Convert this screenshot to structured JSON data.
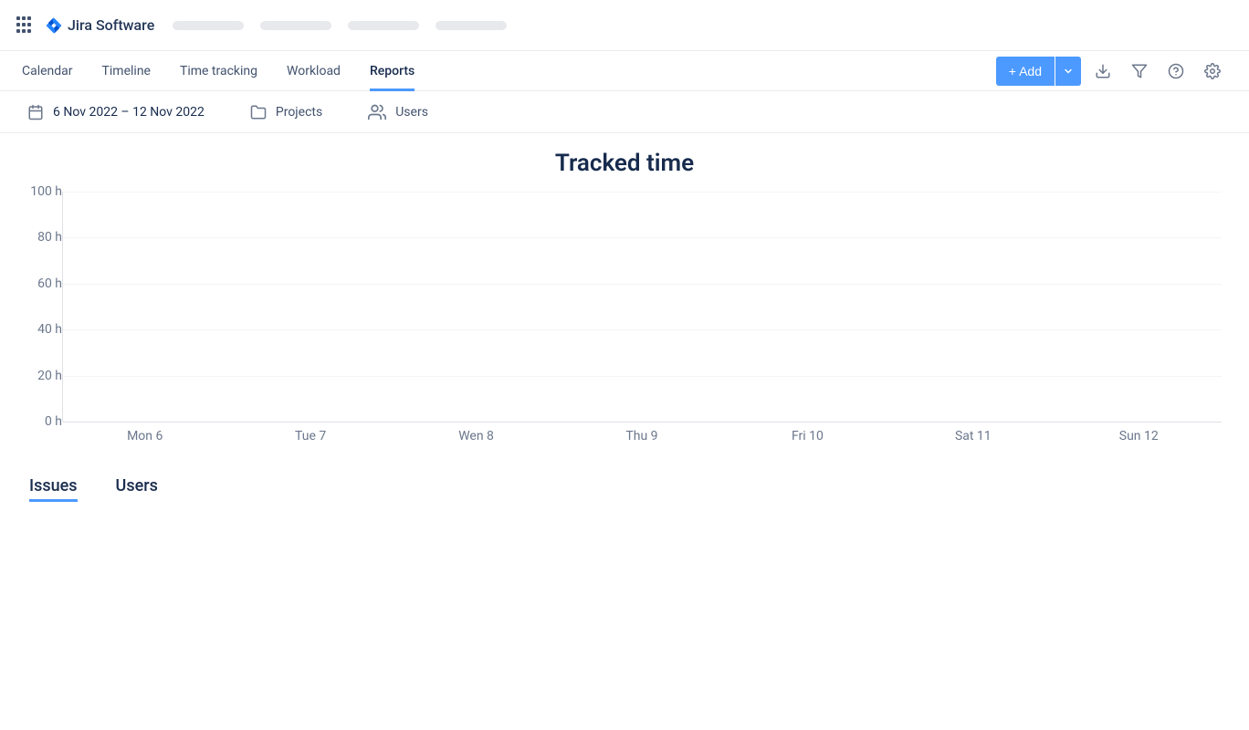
{
  "app_name": "Jira Software",
  "nav": {
    "tabs": [
      "Calendar",
      "Timeline",
      "Time tracking",
      "Workload",
      "Reports"
    ],
    "active_index": 4,
    "add_label": "+ Add"
  },
  "filters": {
    "date_range": "6 Nov 2022 – 12 Nov 2022",
    "projects_label": "Projects",
    "users_label": "Users"
  },
  "chart_data": {
    "type": "bar",
    "title": "Tracked time",
    "xlabel": "",
    "ylabel": "",
    "y_ticks": [
      "100 h",
      "80 h",
      "60 h",
      "40 h",
      "20 h",
      "0 h"
    ],
    "ylim": [
      0,
      100
    ],
    "categories": [
      "Mon 6",
      "Tue 7",
      "Wen 8",
      "Thu 9",
      "Fri 10",
      "Sat 11",
      "Sun 12"
    ],
    "values": [
      0,
      0,
      0,
      0,
      0,
      0,
      0
    ]
  },
  "lower_tabs": {
    "items": [
      "Issues",
      "Users"
    ],
    "active_index": 0
  }
}
